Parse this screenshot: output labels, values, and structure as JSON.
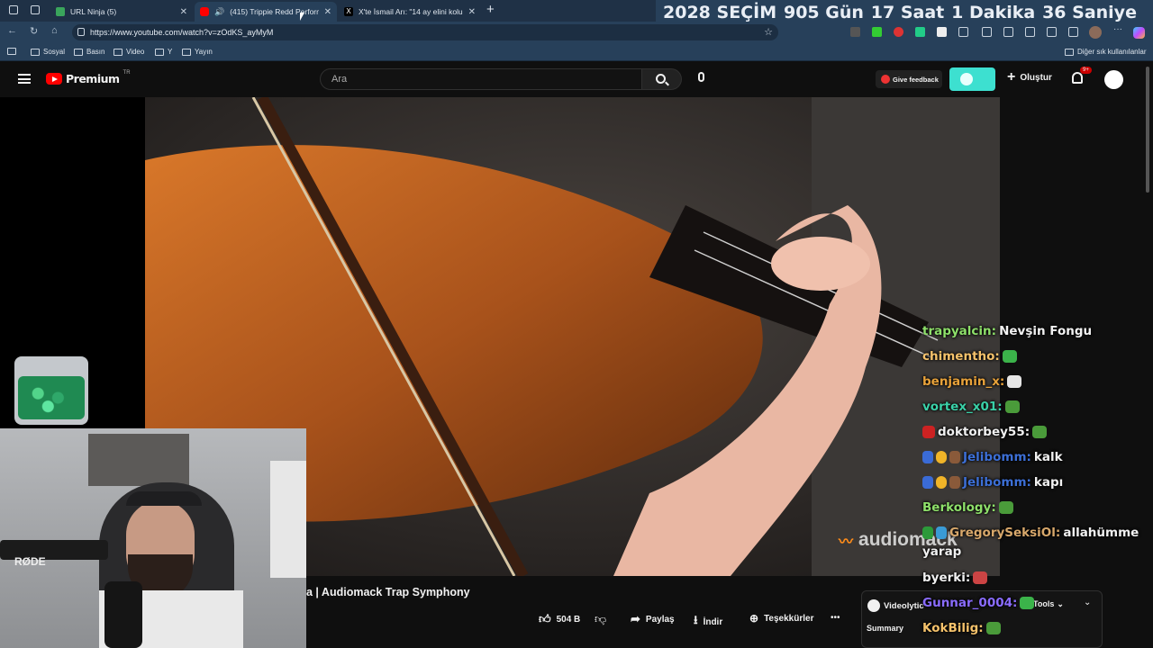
{
  "browser": {
    "tabs": [
      {
        "title": "URL Ninja (5)",
        "active": false
      },
      {
        "title": "(415) Trippie Redd Performs",
        "active": true
      },
      {
        "title": "X'te İsmail Arı: \"14 ay elini kolu sa",
        "active": false
      }
    ],
    "new_tab_label": "+",
    "url": "https://www.youtube.com/watch?v=zOdKS_ayMyM",
    "bookmarks": [
      "Sosyal",
      "Basın",
      "Video",
      "Y",
      "Yayın"
    ],
    "other_bookmarks": "Diğer sık kullanılanlar"
  },
  "countdown": {
    "year": "2028",
    "label": "SEÇİM",
    "days": "905",
    "days_unit": "Gün",
    "hours": "17",
    "hours_unit": "Saat",
    "minutes": "1",
    "minutes_unit": "Dakika",
    "seconds": "36",
    "seconds_unit": "Saniye"
  },
  "youtube": {
    "logo_text": "Premium",
    "logo_region": "TR",
    "search_placeholder": "Ara",
    "feedback_label": "Give feedback",
    "create_label": "Oluştur",
    "notif_badge": "9+",
    "video_title_partial": "a | Audiomack Trap Symphony",
    "watermark": "audiomack",
    "actions": {
      "like_count": "504 B",
      "share": "Paylaş",
      "download": "İndir",
      "thanks": "Teşekkürler",
      "more": "•••"
    },
    "summary_panel": {
      "label": "Videolytic",
      "tools": "Tools",
      "summary": "Summary"
    }
  },
  "chat": [
    {
      "user": "trapyalcin:",
      "text": "Nevşin Fongu",
      "color": "#8ee06a"
    },
    {
      "user": "chimentho:",
      "text": "",
      "color": "#f5c26b",
      "emote": "frog"
    },
    {
      "user": "benjamin_x:",
      "text": "",
      "color": "#e8a23a",
      "emote": "feather"
    },
    {
      "user": "vortex_x01:",
      "text": "",
      "color": "#3ad1a8",
      "emote": "frog"
    },
    {
      "user": "doktorbey55:",
      "text": "",
      "color": "#f1f1f1",
      "emote": "frog"
    },
    {
      "user": "Jelibomm:",
      "text": "kalk",
      "color": "#3c6fd6",
      "emote": ""
    },
    {
      "user": "Jelibomm:",
      "text": "kapı",
      "color": "#3c6fd6",
      "emote": ""
    },
    {
      "user": "Berkology:",
      "text": "",
      "color": "#8ee06a",
      "emote": "frog"
    },
    {
      "user": "GregorySeksiOl:",
      "text": "allahümme",
      "color": "#d8a86b",
      "emote": ""
    },
    {
      "user": "",
      "text": "yarap",
      "color": "#f1f1f1",
      "emote": ""
    },
    {
      "user": "byerki:",
      "text": "",
      "color": "#f1f1f1",
      "emote": "face"
    },
    {
      "user": "Gunnar_0004:",
      "text": "",
      "color": "#8a6cff",
      "emote": "frog"
    },
    {
      "user": "KokBilig:",
      "text": "",
      "color": "#f5c26b",
      "emote": "frog"
    }
  ],
  "webcam": {
    "mic_brand": "RØDE"
  }
}
